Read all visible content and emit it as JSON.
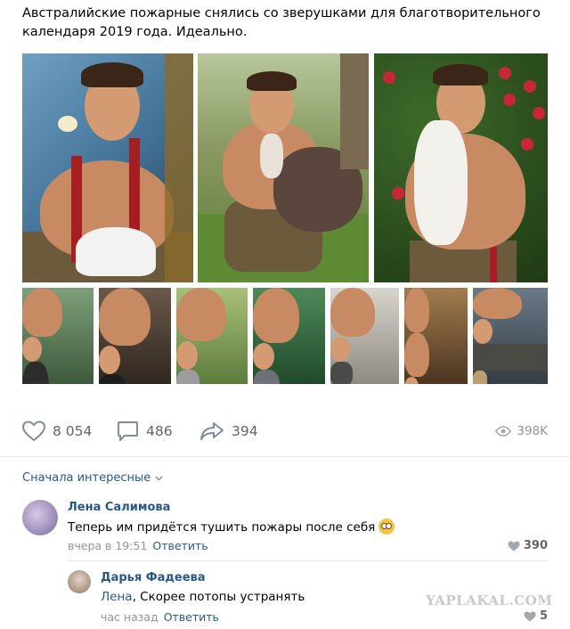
{
  "post": {
    "text": "Австралийские пожарные снялись со зверушками для благотворительного календаря 2019 года. Идеально."
  },
  "photos": {
    "main": [
      {
        "name": "photo-firefighter-duckling"
      },
      {
        "name": "photo-firefighter-alpaca"
      },
      {
        "name": "photo-firefighter-lamb"
      }
    ],
    "thumbs_count": 7
  },
  "actions": {
    "likes": "8 054",
    "comments": "486",
    "shares": "394",
    "views": "398K"
  },
  "comments_sort": {
    "label": "Сначала интересные"
  },
  "comments": [
    {
      "author": "Лена Салимова",
      "text": "Теперь им придётся тушить пожары после себя",
      "time": "вчера в 19:51",
      "reply_label": "Ответить",
      "likes": "390"
    },
    {
      "author": "Дарья Фадеева",
      "mention": "Лена",
      "text": ", Скорее потопы устранять",
      "time": "час назад",
      "reply_label": "Ответить",
      "likes": "5"
    }
  ],
  "watermark": "YAPLAKAL.COM",
  "colors": {
    "link": "#2a5885",
    "muted": "#939393",
    "icon": "#818c99"
  }
}
